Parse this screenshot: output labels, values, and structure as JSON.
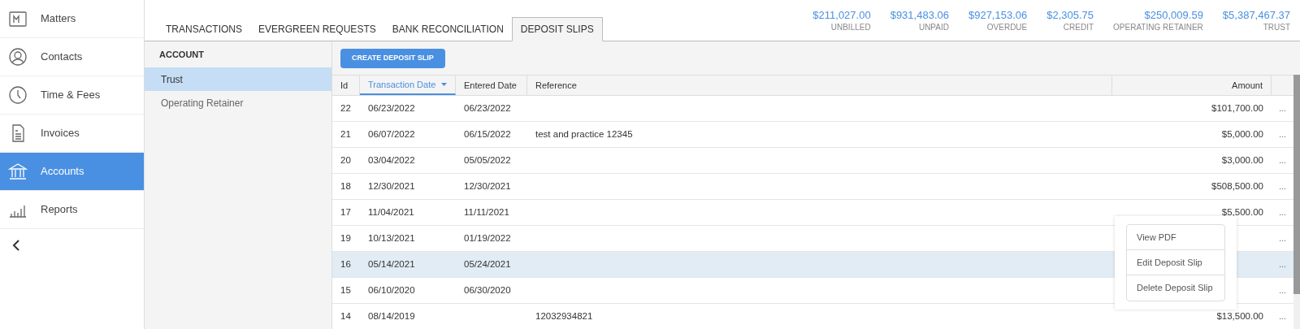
{
  "sidebar": {
    "items": [
      {
        "label": "Matters",
        "kind": "matters",
        "selected": false
      },
      {
        "label": "Contacts",
        "kind": "contacts",
        "selected": false
      },
      {
        "label": "Time & Fees",
        "kind": "time",
        "selected": false
      },
      {
        "label": "Invoices",
        "kind": "invoices",
        "selected": false
      },
      {
        "label": "Accounts",
        "kind": "accounts",
        "selected": true
      },
      {
        "label": "Reports",
        "kind": "reports",
        "selected": false
      }
    ]
  },
  "tabs": [
    {
      "label": "TRANSACTIONS",
      "selected": false
    },
    {
      "label": "EVERGREEN REQUESTS",
      "selected": false
    },
    {
      "label": "BANK RECONCILIATION",
      "selected": false
    },
    {
      "label": "DEPOSIT SLIPS",
      "selected": true
    }
  ],
  "totals": [
    {
      "amount": "$211,027.00",
      "label": "UNBILLED"
    },
    {
      "amount": "$931,483.06",
      "label": "UNPAID"
    },
    {
      "amount": "$927,153.06",
      "label": "OVERDUE"
    },
    {
      "amount": "$2,305.75",
      "label": "CREDIT"
    },
    {
      "amount": "$250,009.59",
      "label": "OPERATING RETAINER"
    },
    {
      "amount": "$5,387,467.37",
      "label": "TRUST"
    }
  ],
  "accounts": {
    "heading": "ACCOUNT",
    "items": [
      {
        "label": "Trust",
        "selected": true
      },
      {
        "label": "Operating Retainer",
        "selected": false
      }
    ]
  },
  "create_button": "CREATE DEPOSIT SLIP",
  "table": {
    "columns": [
      {
        "label": "Id",
        "sorted": false
      },
      {
        "label": "Transaction Date",
        "sorted": true
      },
      {
        "label": "Entered Date",
        "sorted": false
      },
      {
        "label": "Reference",
        "sorted": false
      },
      {
        "label": "Amount",
        "sorted": false
      }
    ],
    "rows": [
      {
        "id": "22",
        "transaction_date": "06/23/2022",
        "entered_date": "06/23/2022",
        "reference": "",
        "amount": "$101,700.00",
        "menu": "...",
        "selected": false
      },
      {
        "id": "21",
        "transaction_date": "06/07/2022",
        "entered_date": "06/15/2022",
        "reference": "test and practice 12345",
        "amount": "$5,000.00",
        "menu": "...",
        "selected": false
      },
      {
        "id": "20",
        "transaction_date": "03/04/2022",
        "entered_date": "05/05/2022",
        "reference": "",
        "amount": "$3,000.00",
        "menu": "...",
        "selected": false
      },
      {
        "id": "18",
        "transaction_date": "12/30/2021",
        "entered_date": "12/30/2021",
        "reference": "",
        "amount": "$508,500.00",
        "menu": "...",
        "selected": false
      },
      {
        "id": "17",
        "transaction_date": "11/04/2021",
        "entered_date": "11/11/2021",
        "reference": "",
        "amount": "$5,500.00",
        "menu": "...",
        "selected": false
      },
      {
        "id": "19",
        "transaction_date": "10/13/2021",
        "entered_date": "01/19/2022",
        "reference": "",
        "amount": "",
        "menu": "...",
        "selected": false
      },
      {
        "id": "16",
        "transaction_date": "05/14/2021",
        "entered_date": "05/24/2021",
        "reference": "",
        "amount": "",
        "menu": "...",
        "selected": true
      },
      {
        "id": "15",
        "transaction_date": "06/10/2020",
        "entered_date": "06/30/2020",
        "reference": "",
        "amount": "",
        "menu": "...",
        "selected": false
      },
      {
        "id": "14",
        "transaction_date": "08/14/2019",
        "entered_date": "",
        "reference": "12032934821",
        "amount": "$13,500.00",
        "menu": "...",
        "selected": false
      }
    ]
  },
  "row_menu": [
    "View PDF",
    "Edit Deposit Slip",
    "Delete Deposit Slip"
  ]
}
